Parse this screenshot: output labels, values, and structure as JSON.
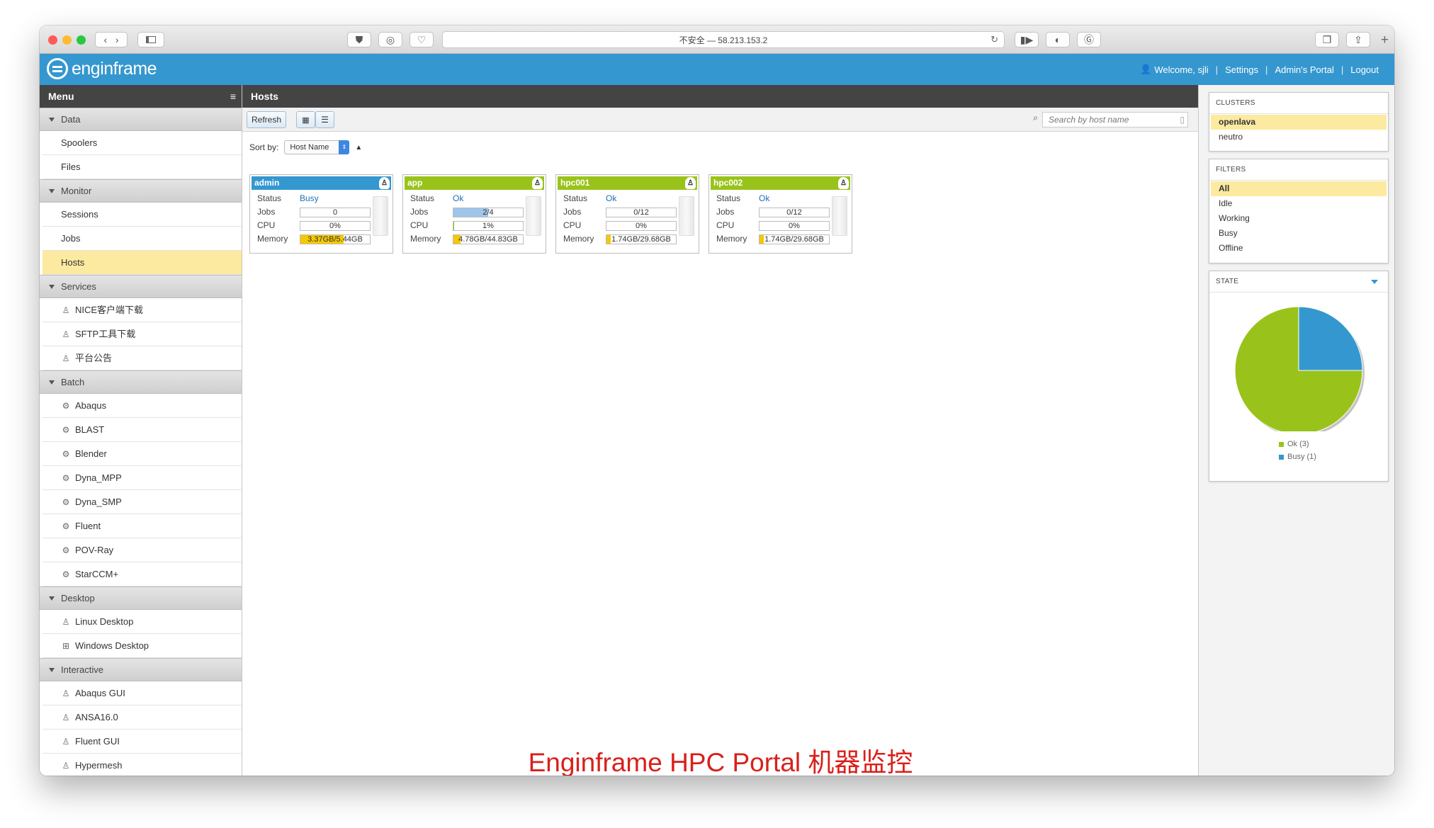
{
  "browser": {
    "address": "不安全 — 58.213.153.2"
  },
  "header": {
    "logo_text": "enginframe",
    "welcome": "Welcome, sjli",
    "links": [
      "Settings",
      "Admin's Portal",
      "Logout"
    ]
  },
  "menu": {
    "title": "Menu",
    "sections": [
      {
        "label": "Data",
        "items": [
          {
            "label": "Spoolers",
            "icon": ""
          },
          {
            "label": "Files",
            "icon": ""
          }
        ]
      },
      {
        "label": "Monitor",
        "items": [
          {
            "label": "Sessions",
            "icon": ""
          },
          {
            "label": "Jobs",
            "icon": ""
          },
          {
            "label": "Hosts",
            "icon": "",
            "selected": true
          }
        ]
      },
      {
        "label": "Services",
        "items": [
          {
            "label": "NICE客户端下载",
            "icon": "linux"
          },
          {
            "label": "SFTP工具下载",
            "icon": "linux"
          },
          {
            "label": "平台公告",
            "icon": "linux"
          }
        ]
      },
      {
        "label": "Batch",
        "items": [
          {
            "label": "Abaqus",
            "icon": "gears"
          },
          {
            "label": "BLAST",
            "icon": "gears"
          },
          {
            "label": "Blender",
            "icon": "gears"
          },
          {
            "label": "Dyna_MPP",
            "icon": "gears"
          },
          {
            "label": "Dyna_SMP",
            "icon": "gears"
          },
          {
            "label": "Fluent",
            "icon": "gears"
          },
          {
            "label": "POV-Ray",
            "icon": "gears"
          },
          {
            "label": "StarCCM+",
            "icon": "gears"
          }
        ]
      },
      {
        "label": "Desktop",
        "items": [
          {
            "label": "Linux Desktop",
            "icon": "linux"
          },
          {
            "label": "Windows Desktop",
            "icon": "windows"
          }
        ]
      },
      {
        "label": "Interactive",
        "items": [
          {
            "label": "Abaqus GUI",
            "icon": "linux"
          },
          {
            "label": "ANSA16.0",
            "icon": "linux"
          },
          {
            "label": "Fluent GUI",
            "icon": "linux"
          },
          {
            "label": "Hypermesh",
            "icon": "linux"
          }
        ]
      }
    ]
  },
  "main": {
    "title": "Hosts",
    "refresh_label": "Refresh",
    "search_placeholder": "Search by host name",
    "sort_label": "Sort by:",
    "sort_value": "Host Name",
    "labels": {
      "status": "Status",
      "jobs": "Jobs",
      "cpu": "CPU",
      "memory": "Memory"
    },
    "colors": {
      "busy": "#3597cf",
      "ok": "#99c31a",
      "jobs_fill": "#9fc5ea",
      "cpu_fill": "#99c31a",
      "mem_fill": "#f5c800"
    },
    "hosts": [
      {
        "name": "admin",
        "state": "busy",
        "status": "Busy",
        "jobs": "0",
        "jobs_frac": 0,
        "cpu": "0%",
        "cpu_frac": 0,
        "memory": "3.37GB/5.44GB",
        "mem_frac": 0.62
      },
      {
        "name": "app",
        "state": "ok",
        "status": "Ok",
        "jobs": "2/4",
        "jobs_frac": 0.5,
        "cpu": "1%",
        "cpu_frac": 0.01,
        "memory": "4.78GB/44.83GB",
        "mem_frac": 0.107
      },
      {
        "name": "hpc001",
        "state": "ok",
        "status": "Ok",
        "jobs": "0/12",
        "jobs_frac": 0,
        "cpu": "0%",
        "cpu_frac": 0,
        "memory": "1.74GB/29.68GB",
        "mem_frac": 0.059
      },
      {
        "name": "hpc002",
        "state": "ok",
        "status": "Ok",
        "jobs": "0/12",
        "jobs_frac": 0,
        "cpu": "0%",
        "cpu_frac": 0,
        "memory": "1.74GB/29.68GB",
        "mem_frac": 0.059
      }
    ],
    "caption": "Enginframe HPC Portal 机器监控"
  },
  "right": {
    "clusters": {
      "title": "CLUSTERS",
      "items": [
        "openlava",
        "neutro"
      ],
      "selected": 0
    },
    "filters": {
      "title": "FILTERS",
      "items": [
        "All",
        "Idle",
        "Working",
        "Busy",
        "Offline"
      ],
      "selected": 0
    },
    "state": {
      "title": "STATE"
    }
  },
  "chart_data": {
    "type": "pie",
    "categories": [
      "Ok",
      "Busy"
    ],
    "values": [
      3,
      1
    ],
    "legend": [
      "Ok (3)",
      "Busy (1)"
    ],
    "colors": [
      "#99c31a",
      "#3597cf"
    ],
    "legend_position": "bottom"
  }
}
